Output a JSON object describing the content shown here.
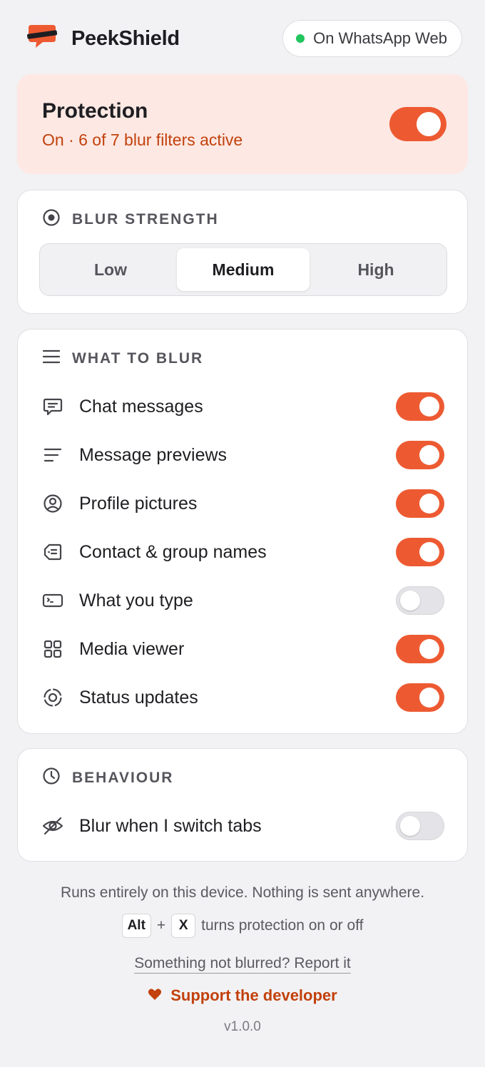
{
  "app": {
    "name": "PeekShield",
    "logo_icon": "peekshield-logo-icon"
  },
  "status": {
    "label": "On WhatsApp Web",
    "dot_color": "#22c55e"
  },
  "protection": {
    "title": "Protection",
    "subtitle": "On · 6 of 7 blur filters active",
    "enabled": true
  },
  "blur_strength": {
    "heading": "BLUR STRENGTH",
    "options": [
      "Low",
      "Medium",
      "High"
    ],
    "selected": "Medium"
  },
  "what_to_blur": {
    "heading": "WHAT TO BLUR",
    "items": [
      {
        "label": "Chat messages",
        "icon": "chat-bubble-icon",
        "enabled": true
      },
      {
        "label": "Message previews",
        "icon": "text-lines-icon",
        "enabled": true
      },
      {
        "label": "Profile pictures",
        "icon": "user-circle-icon",
        "enabled": true
      },
      {
        "label": "Contact & group names",
        "icon": "contact-tag-icon",
        "enabled": true
      },
      {
        "label": "What you type",
        "icon": "text-input-icon",
        "enabled": false
      },
      {
        "label": "Media viewer",
        "icon": "grid-icon",
        "enabled": true
      },
      {
        "label": "Status updates",
        "icon": "status-ring-icon",
        "enabled": true
      }
    ]
  },
  "behaviour": {
    "heading": "BEHAVIOUR",
    "items": [
      {
        "label": "Blur when I switch tabs",
        "icon": "eye-off-icon",
        "enabled": false
      }
    ]
  },
  "footer": {
    "privacy": "Runs entirely on this device. Nothing is sent anywhere.",
    "shortcut_key1": "Alt",
    "shortcut_plus": "+",
    "shortcut_key2": "X",
    "shortcut_text": "turns protection on or off",
    "report_link": "Something not blurred? Report it",
    "support_link": "Support the developer",
    "version": "v1.0.0"
  },
  "colors": {
    "accent": "#ed5a32",
    "accent_text": "#c2410c",
    "protection_bg": "#fde8e3"
  }
}
